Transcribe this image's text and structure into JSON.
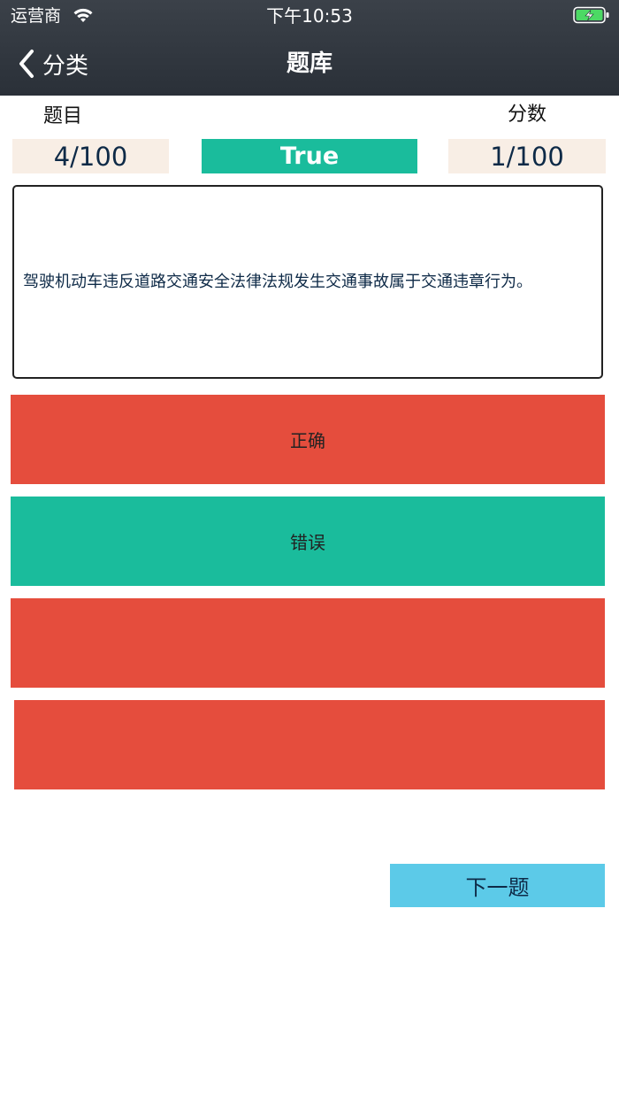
{
  "status_bar": {
    "carrier": "运营商",
    "time": "下午10:53",
    "wifi_icon": "wifi-icon",
    "battery_icon": "battery-charging-icon",
    "battery_color": "#4cd964"
  },
  "nav": {
    "back_label": "分类",
    "back_icon": "chevron-left-icon",
    "title": "题库"
  },
  "quiz": {
    "question_label": "题目",
    "score_label": "分数",
    "progress": "4/100",
    "result": "True",
    "score": "1/100",
    "question_text": "驾驶机动车违反道路交通安全法律法规发生交通事故属于交通违章行为。",
    "options": [
      {
        "label": "正确",
        "color": "#e54d3d"
      },
      {
        "label": "错误",
        "color": "#1abc9c"
      },
      {
        "label": "",
        "color": "#e54d3d"
      },
      {
        "label": "",
        "color": "#e54d3d"
      }
    ],
    "next_label": "下一题"
  },
  "colors": {
    "header_bg": "#2e343c",
    "accent_green": "#1abc9c",
    "accent_red": "#e54d3d",
    "next_button": "#5ccae8",
    "info_box_bg": "#f8eee5",
    "text_dark": "#0e2a47"
  }
}
